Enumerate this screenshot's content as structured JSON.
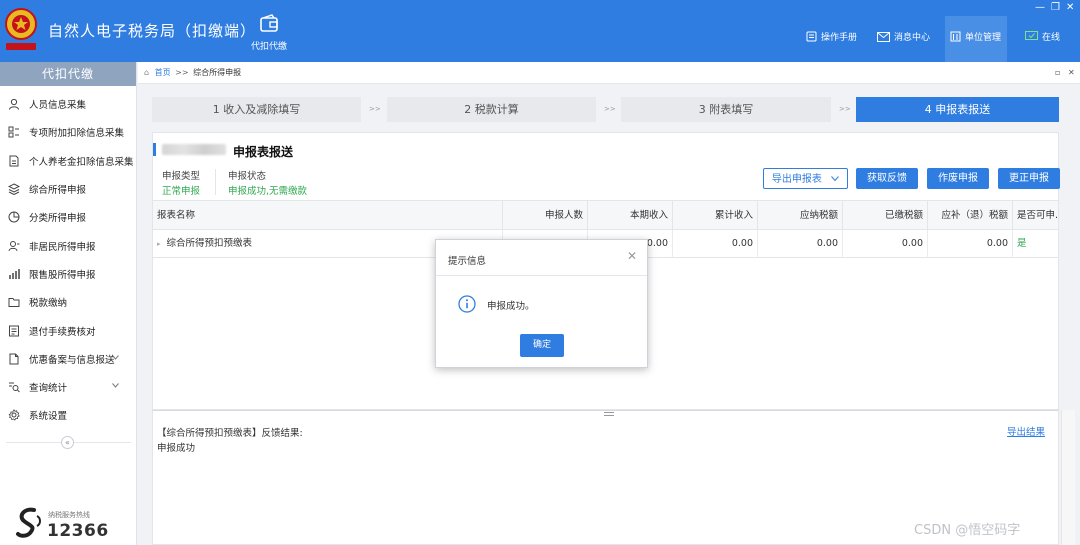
{
  "app": {
    "title": "自然人电子税务局（扣缴端）"
  },
  "top": {
    "module_label": "代扣代缴",
    "menu": [
      "操作手册",
      "消息中心",
      "单位管理",
      "在线"
    ]
  },
  "sidebar": {
    "header": "代扣代缴",
    "items": [
      {
        "label": "人员信息采集",
        "icon": "person-icon"
      },
      {
        "label": "专项附加扣除信息采集",
        "icon": "list-grid-icon"
      },
      {
        "label": "个人养老金扣除信息采集",
        "icon": "document-icon"
      },
      {
        "label": "综合所得申报",
        "icon": "layers-icon"
      },
      {
        "label": "分类所得申报",
        "icon": "pie-chart-icon"
      },
      {
        "label": "非居民所得申报",
        "icon": "user-badge-icon"
      },
      {
        "label": "限售股所得申报",
        "icon": "bar-chart-icon"
      },
      {
        "label": "税款缴纳",
        "icon": "folder-icon"
      },
      {
        "label": "退付手续费核对",
        "icon": "checklist-icon"
      },
      {
        "label": "优惠备案与信息报送",
        "icon": "file-icon",
        "expandable": true
      },
      {
        "label": "查询统计",
        "icon": "search-list-icon",
        "expandable": true
      },
      {
        "label": "系统设置",
        "icon": "gear-icon"
      }
    ],
    "collapse_glyph": "«",
    "hotline_label": "纳税服务热线",
    "hotline_number": "12366"
  },
  "breadcrumb": {
    "home": "首页",
    "separator": ">>",
    "current": "综合所得申报"
  },
  "steps": [
    {
      "label": "1 收入及减除填写",
      "active": false
    },
    {
      "label": "2 税款计算",
      "active": false
    },
    {
      "label": "3 附表填写",
      "active": false
    },
    {
      "label": "4 申报表报送",
      "active": true
    }
  ],
  "step_arrow": ">>",
  "panel": {
    "title": "申报表报送",
    "meta": {
      "type_label": "申报类型",
      "type_value": "正常申报",
      "status_label": "申报状态",
      "status_value": "申报成功,无需缴款"
    },
    "buttons": {
      "export": "导出申报表",
      "feedback": "获取反馈",
      "void": "作废申报",
      "correct": "更正申报"
    }
  },
  "table": {
    "columns": [
      "报表名称",
      "申报人数",
      "本期收入",
      "累计收入",
      "应纳税额",
      "已缴税额",
      "应补（退）税额",
      "是否可申..."
    ],
    "rows": [
      {
        "name": "综合所得预扣预缴表",
        "people": "",
        "income": "0.00",
        "cumulative": "0.00",
        "tax_due": "0.00",
        "paid": "0.00",
        "refund": "0.00",
        "can_declare": "是"
      }
    ]
  },
  "feedback": {
    "title": "【综合所得预扣预缴表】反馈结果:",
    "text": "申报成功",
    "export_link": "导出结果"
  },
  "modal": {
    "title": "提示信息",
    "message": "申报成功。",
    "ok": "确定"
  },
  "watermark": "CSDN @悟空码字",
  "colors": {
    "primary": "#2f7de1",
    "success": "#2fa84f",
    "sidebar_head": "#8fa4bf"
  }
}
